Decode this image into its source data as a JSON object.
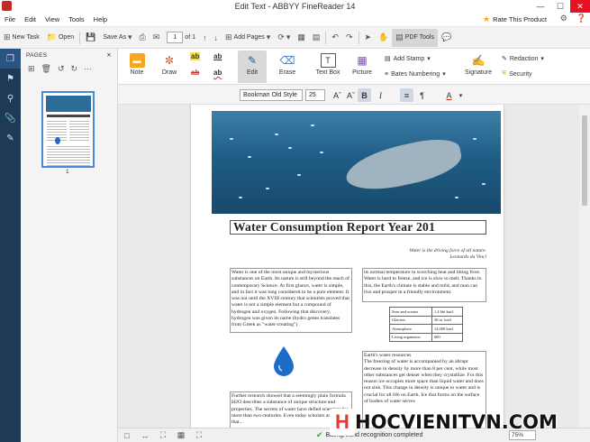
{
  "window": {
    "title": "Edit Text - ABBYY FineReader 14"
  },
  "menu": {
    "items": [
      "File",
      "Edit",
      "View",
      "Tools",
      "Help"
    ],
    "rate": "Rate This Product"
  },
  "toolbar": {
    "new_task": "New Task",
    "open": "Open",
    "save_as": "Save As",
    "page_current": "1",
    "page_total": "of 1",
    "add_pages": "Add Pages",
    "pdf_tools": "PDF Tools"
  },
  "pages_panel": {
    "header": "PAGES",
    "thumb_number": "1"
  },
  "ribbon": {
    "note": "Note",
    "draw": "Draw",
    "edit": "Edit",
    "erase": "Erase",
    "text_box": "Text Box",
    "picture": "Picture",
    "add_stamp": "Add Stamp",
    "bates": "Bates Numbering",
    "signature": "Signature",
    "redaction": "Redaction",
    "security": "Security",
    "ab": "ab"
  },
  "format": {
    "font": "Bookman Old Style",
    "size": "25",
    "bold": "B",
    "italic": "I",
    "color": "A"
  },
  "document": {
    "title": "Water Consumption Report Year 201",
    "quote1": "Water is the driving force of all nature.",
    "quote2": "Leonardo da Vinci",
    "col1": "Water is one of the most unique and mysterious substances on Earth. Its nature is still beyond the reach of contemporary Science. At first glance, water is simple, and in fact it was long considered to be a pure element. It was not until the XVIII century that scientists proved that water is not a simple element but a compound of hydrogen and oxygen. Following that discovery, hydrogen was given its name (hydro genes translates from Greek as \"water-creating\")",
    "col2": "its normal temperature in scorching heat and biting frost. Water is hard to freeze, and ice is slow to melt. Thanks to this, the Earth's climate is stable and mild, and man can live and prosper in a friendly environment.",
    "table": [
      [
        "Seas and oceans",
        "1.4 bln km3"
      ],
      [
        "Glaciers",
        "30 m. km3"
      ],
      [
        "Atmosphere",
        "14,000 km3"
      ],
      [
        "Living organisms",
        "600"
      ]
    ],
    "col3": "Further research showed that a seemingly plain formula H2O describes a substance of unique structure and properties. The secrets of water have defied scientists for more than two centuries. Even today scholars are aware that...",
    "col4_head": "Earth's water resources",
    "col4": "The freezing of water is accompanied by an abrupt decrease in density by more than 8 per cent, while most other substances get denser when they crystallize. For this reason ice occupies more space than liquid water and does not sink. This change in density is unique to water and is crucial for all life on Earth. Ice that forms on the surface of bodies of water serves"
  },
  "status": {
    "message": "Background recognition completed",
    "zoom": "75%"
  },
  "watermark": {
    "text": "HOCVIENITVN.COM",
    "logo": "H"
  }
}
